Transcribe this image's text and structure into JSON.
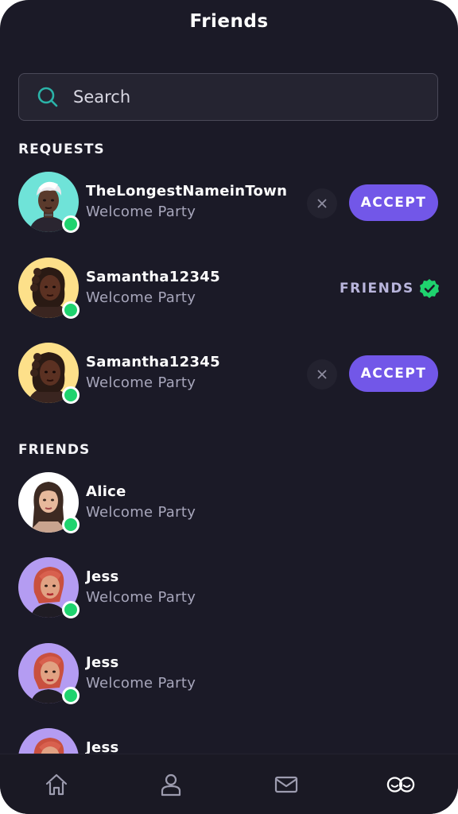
{
  "header": {
    "title": "Friends"
  },
  "search": {
    "placeholder": "Search"
  },
  "requests": {
    "heading": "REQUESTS",
    "items": [
      {
        "name": "TheLongestNameinTown",
        "subtitle": "Welcome Party",
        "state": "pending",
        "accept_label": "ACCEPT"
      },
      {
        "name": "Samantha12345",
        "subtitle": "Welcome Party",
        "state": "accepted",
        "status_label": "FRIENDS"
      },
      {
        "name": "Samantha12345",
        "subtitle": "Welcome Party",
        "state": "pending",
        "accept_label": "ACCEPT"
      }
    ]
  },
  "friends": {
    "heading": "FRIENDS",
    "items": [
      {
        "name": "Alice",
        "subtitle": "Welcome Party"
      },
      {
        "name": "Jess",
        "subtitle": "Welcome Party"
      },
      {
        "name": "Jess",
        "subtitle": "Welcome Party"
      },
      {
        "name": "Jess",
        "subtitle": ""
      }
    ]
  },
  "nav": {
    "items": [
      {
        "icon": "home-icon"
      },
      {
        "icon": "profile-icon"
      },
      {
        "icon": "mail-icon"
      },
      {
        "icon": "friends-icon",
        "active": true
      }
    ]
  },
  "colors": {
    "background": "#1b1a27",
    "accent": "#7257e8",
    "online": "#1fd36e",
    "subtitle": "#a7a6bb",
    "search_icon": "#2bb3a8"
  }
}
